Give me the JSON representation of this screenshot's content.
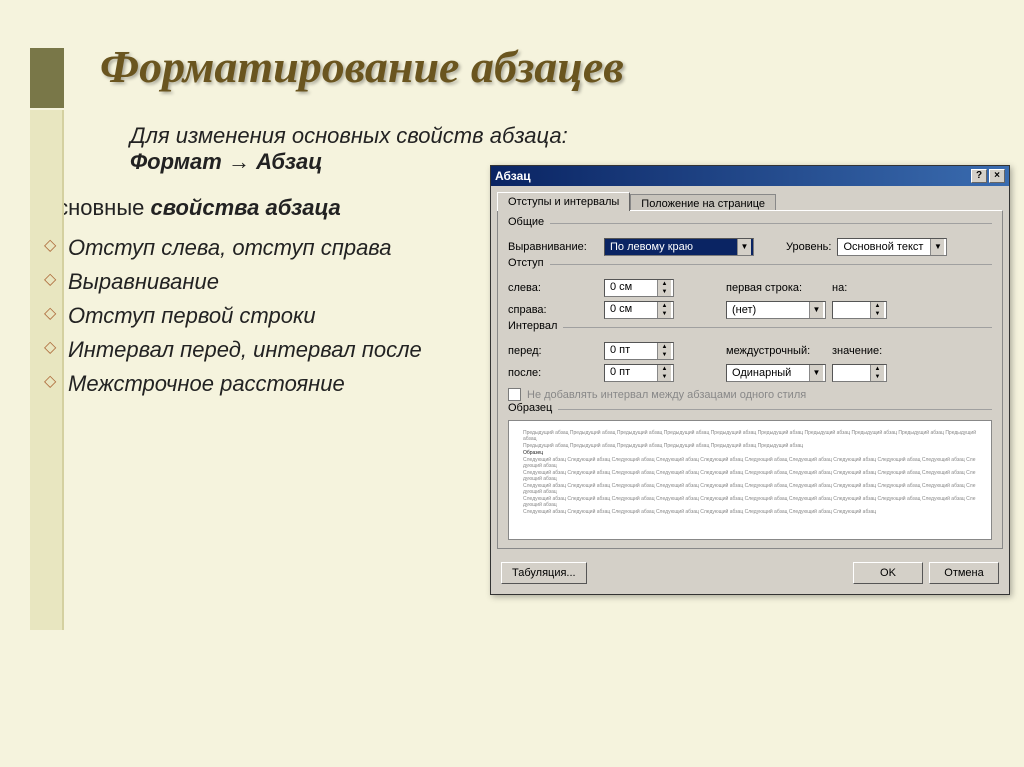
{
  "title": "Форматирование абзацев",
  "intro": {
    "line1": "Для изменения основных свойств абзаца:",
    "line2a": "Формат",
    "arrow": "→",
    "line2b": "Абзац"
  },
  "leftCol": {
    "subtitle_prefix": "Основные ",
    "subtitle_bold": "свойства абзаца",
    "bullets": [
      "Отступ слева, отступ справа",
      "Выравнивание",
      "Отступ первой строки",
      "Интервал перед, интервал после",
      "Межстрочное расстояние"
    ]
  },
  "dialog": {
    "title": "Абзац",
    "help": "?",
    "close": "×",
    "tabs": {
      "active": "Отступы и интервалы",
      "inactive": "Положение на странице"
    },
    "general": {
      "legend": "Общие",
      "align_label": "Выравнивание:",
      "align_value": "По левому краю",
      "level_label": "Уровень:",
      "level_value": "Основной текст"
    },
    "indent": {
      "legend": "Отступ",
      "left_label": "слева:",
      "left_value": "0 см",
      "right_label": "справа:",
      "right_value": "0 см",
      "first_label": "первая строка:",
      "first_value": "(нет)",
      "na_label": "на:"
    },
    "interval": {
      "legend": "Интервал",
      "before_label": "перед:",
      "before_value": "0 пт",
      "after_label": "после:",
      "after_value": "0 пт",
      "line_label": "междустрочный:",
      "line_value": "Одинарный",
      "val_label": "значение:",
      "checkbox": "Не добавлять интервал между абзацами одного стиля"
    },
    "sample": {
      "legend": "Образец"
    },
    "buttons": {
      "tab": "Табуляция...",
      "ok": "OK",
      "cancel": "Отмена"
    }
  }
}
